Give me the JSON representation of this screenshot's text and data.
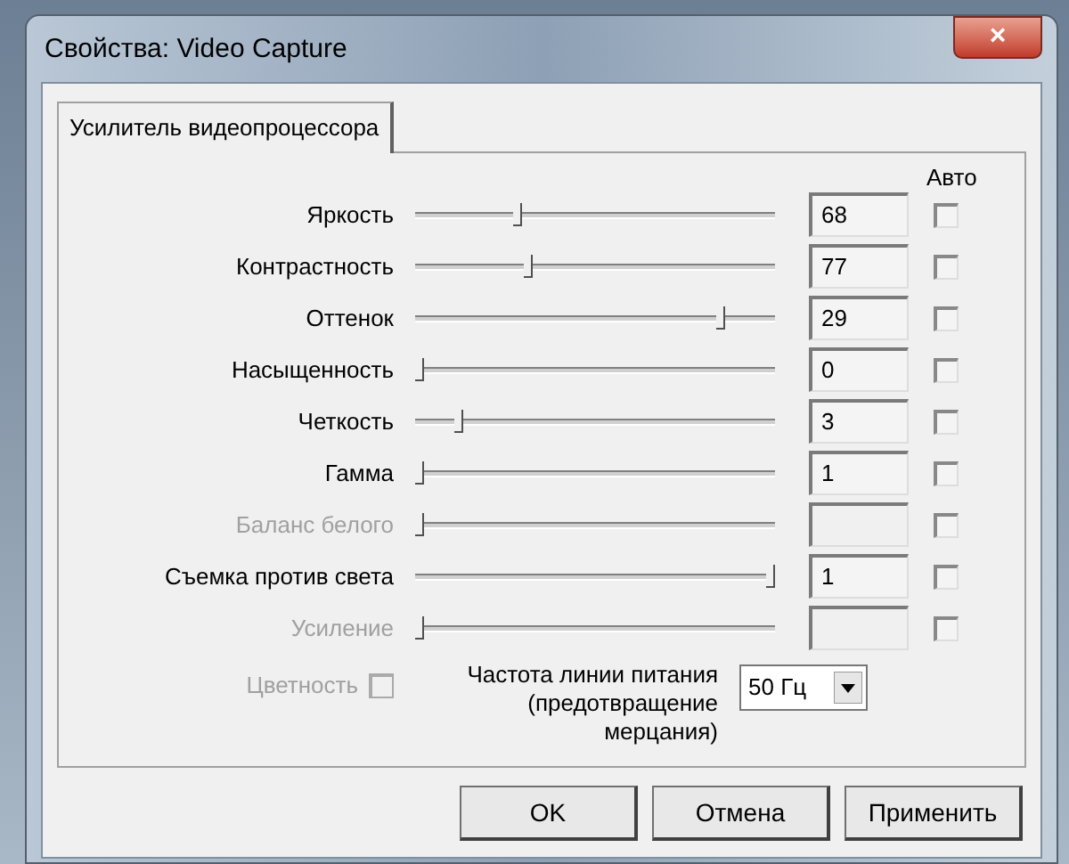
{
  "window": {
    "title": "Свойства: Video Capture",
    "close": "×"
  },
  "tabs": [
    {
      "label": "Усилитель видеопроцессора",
      "selected": true
    }
  ],
  "auto_header": "Авто",
  "rows": [
    {
      "label": "Яркость",
      "level": 0.28,
      "value": "68",
      "auto": false,
      "disabled": false
    },
    {
      "label": "Контрастность",
      "level": 0.31,
      "value": "77",
      "auto": false,
      "disabled": false
    },
    {
      "label": "Оттенок",
      "level": 0.86,
      "value": "29",
      "auto": false,
      "disabled": false
    },
    {
      "label": "Насыщенность",
      "level": 0,
      "value": "0",
      "auto": false,
      "disabled": false
    },
    {
      "label": "Четкость",
      "level": 0.11,
      "value": "3",
      "auto": false,
      "disabled": false
    },
    {
      "label": "Гамма",
      "level": 0,
      "value": "1",
      "auto": false,
      "disabled": false
    },
    {
      "label": "Баланс белого",
      "level": 0,
      "auto": false,
      "disabled": true
    },
    {
      "label": "Съемка против света",
      "level": 1,
      "value": "1",
      "auto": false,
      "disabled": false
    },
    {
      "label": "Усиление",
      "level": 0,
      "auto": false,
      "disabled": true
    }
  ],
  "color_option": {
    "label": "Цветность",
    "checked": false,
    "disabled": true
  },
  "power_line": {
    "label": "Частота линии питания (предотвращение мерцания)",
    "value": "50 Гц"
  },
  "buttons": [
    "OK",
    "Отмена",
    "Применить"
  ]
}
